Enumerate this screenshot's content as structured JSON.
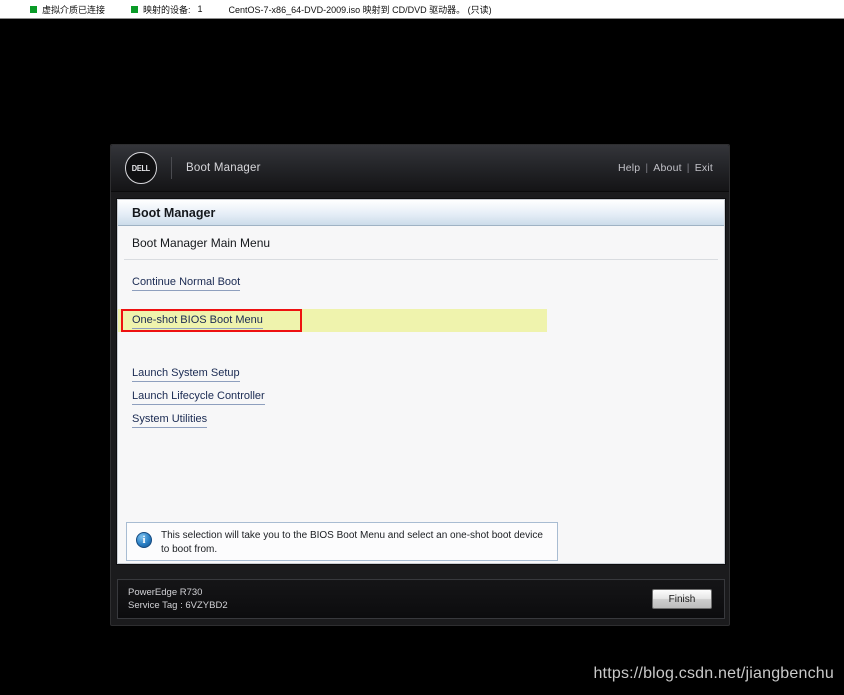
{
  "virtual_media_bar": {
    "status_label": "虚拟介质已连接",
    "mapped_devices_label": "映射的设备:",
    "mapped_devices_count": "1",
    "iso_description": "CentOS-7-x86_64-DVD-2009.iso 映射到 CD/DVD 驱动器。 (只读)",
    "indicator_color": "#0a9b28"
  },
  "boot_manager": {
    "header": {
      "logo_text": "DELL",
      "title": "Boot Manager",
      "links": [
        {
          "label": "Help"
        },
        {
          "label": "About"
        },
        {
          "label": "Exit"
        }
      ],
      "separator": "|"
    },
    "panel": {
      "title": "Boot Manager",
      "subtitle": "Boot Manager Main Menu",
      "menu_items": [
        {
          "label": "Continue Normal Boot",
          "highlighted": false
        },
        {
          "label": "One-shot BIOS Boot Menu",
          "highlighted": true
        },
        {
          "label": "Launch System Setup",
          "highlighted": false
        },
        {
          "label": "Launch Lifecycle Controller",
          "highlighted": false
        },
        {
          "label": "System Utilities",
          "highlighted": false
        }
      ],
      "highlight_color": "#eff3ad",
      "annotation_color": "#ee1111",
      "link_color": "#1a2a52"
    },
    "info": {
      "icon": "info-icon",
      "message": "This selection will take you to the BIOS Boot Menu and select an one-shot boot device to boot from."
    },
    "footer": {
      "model": "PowerEdge R730",
      "service_tag": "Service Tag : 6VZYBD2",
      "finish_label": "Finish"
    }
  },
  "watermark": {
    "url": "https://blog.csdn.net/jiangbenchu"
  }
}
